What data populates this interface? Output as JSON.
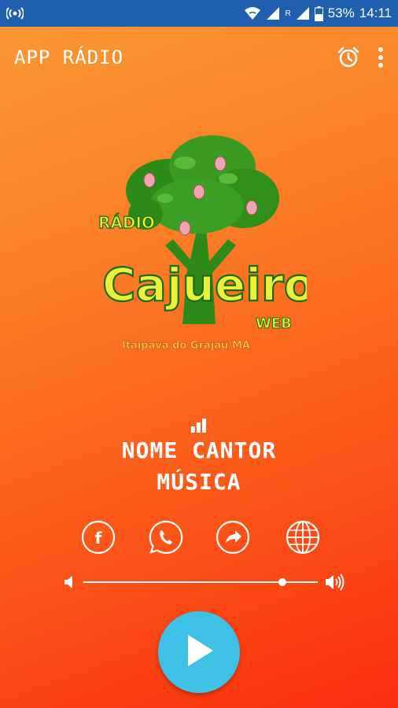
{
  "status_bar": {
    "battery": "53%",
    "time": "14:11",
    "network_badge": "R",
    "icons": [
      "radio-broadcast-icon",
      "wifi-icon",
      "signal-icon",
      "battery-icon"
    ]
  },
  "app_bar": {
    "title": "APP RÁDIO",
    "icons": [
      "alarm-icon",
      "more-vert-icon"
    ]
  },
  "logo": {
    "top_word": "RÁDIO",
    "name": "Cajueiro",
    "suffix": "WEB",
    "location": "Itaipava do Grajaú/MA"
  },
  "now_playing": {
    "artist": "NOME CANTOR",
    "song": "MÚSICA"
  },
  "social": [
    {
      "name": "facebook-icon"
    },
    {
      "name": "whatsapp-icon"
    },
    {
      "name": "share-icon"
    },
    {
      "name": "globe-icon"
    }
  ],
  "volume": {
    "level": 0.85
  },
  "colors": {
    "status_bar": "#1f5fb0",
    "play_button": "#3fc0e6",
    "background_top": "#f99a35",
    "background_bottom": "#f92e0e"
  }
}
